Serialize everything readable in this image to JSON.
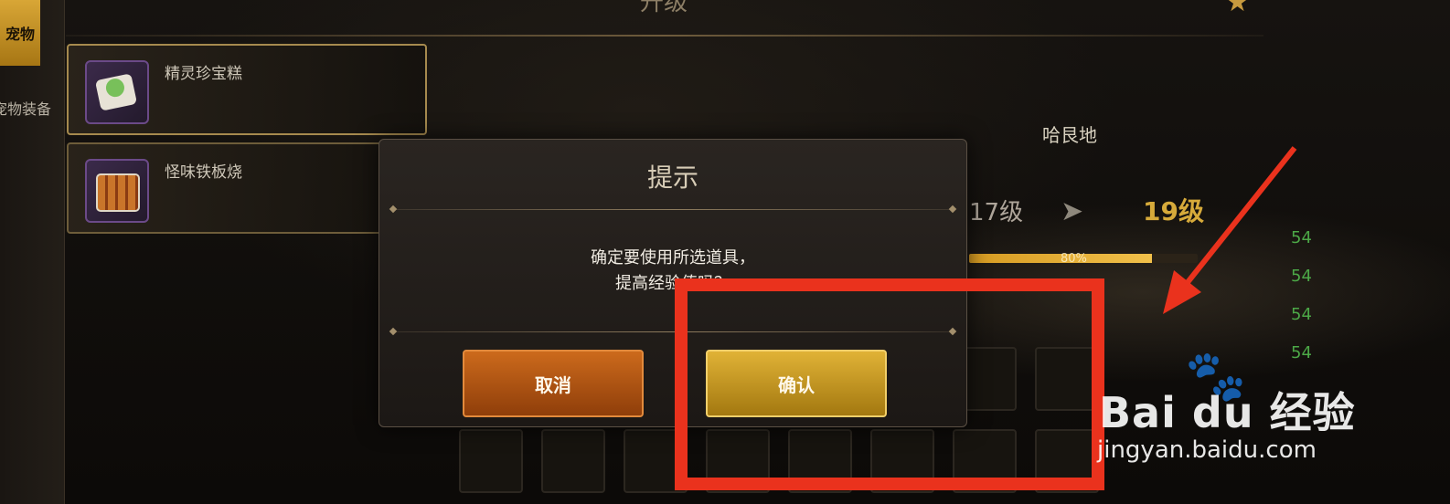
{
  "header": {
    "title": "升级"
  },
  "left_tabs": [
    {
      "label": "宠物"
    },
    {
      "label": "宠物装备"
    }
  ],
  "items": [
    {
      "name": "精灵珍宝糕",
      "icon": "cake-icon"
    },
    {
      "name": "怪味铁板烧",
      "icon": "grill-icon"
    }
  ],
  "pet_info": {
    "name": "哈艮地",
    "level_from": "17级",
    "level_to": "19级",
    "exp_percent_text": "80%",
    "exp_percent": 0.8
  },
  "side_numbers": [
    "54",
    "54",
    "54",
    "54"
  ],
  "modal": {
    "title": "提示",
    "message_line1": "确定要使用所选道具，",
    "message_line2": "提高经验值吗？",
    "cancel_label": "取消",
    "confirm_label": "确认"
  },
  "watermark": {
    "logo": "Bai du 经验",
    "url": "jingyan.baidu.com"
  },
  "colors": {
    "accent_gold": "#d6aa3a",
    "cancel_orange": "#cc6a1c",
    "confirm_gold": "#e0b236",
    "annotation_red": "#ea321d"
  }
}
